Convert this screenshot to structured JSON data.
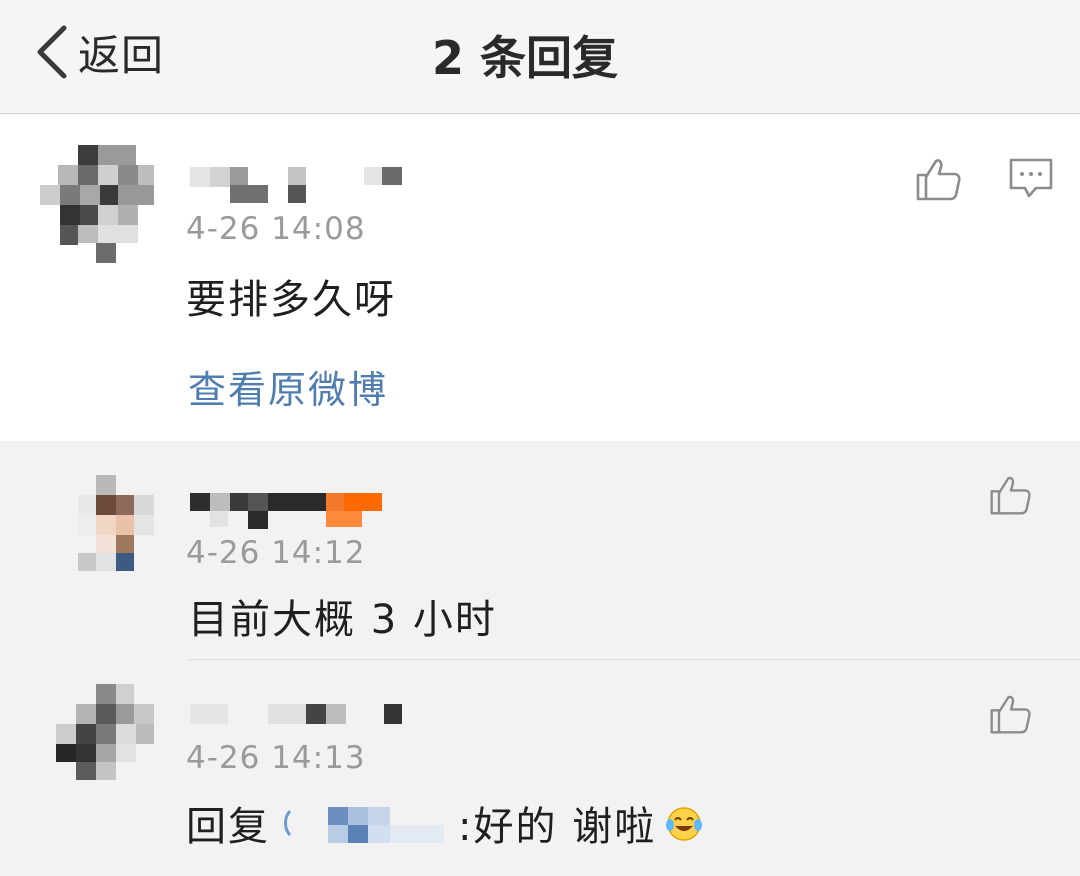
{
  "header": {
    "back_label": "返回",
    "title": "2 条回复"
  },
  "main_comment": {
    "timestamp": "4-26 14:08",
    "text": "要排多久呀",
    "view_original_label": "查看原微博"
  },
  "replies": [
    {
      "timestamp": "4-26 14:12",
      "text": "目前大概 3 小时"
    },
    {
      "timestamp": "4-26 14:13",
      "text_prefix": "回复",
      "text_suffix": ":好的 谢啦"
    }
  ],
  "colors": {
    "link": "#507daf",
    "timestamp": "#9a9a9a",
    "icon": "#8c8c8c"
  },
  "icons": {
    "back": "chevron-left-icon",
    "like": "thumbs-up-icon",
    "reply": "comment-icon",
    "emoji": "laughing-tears-emoji"
  }
}
